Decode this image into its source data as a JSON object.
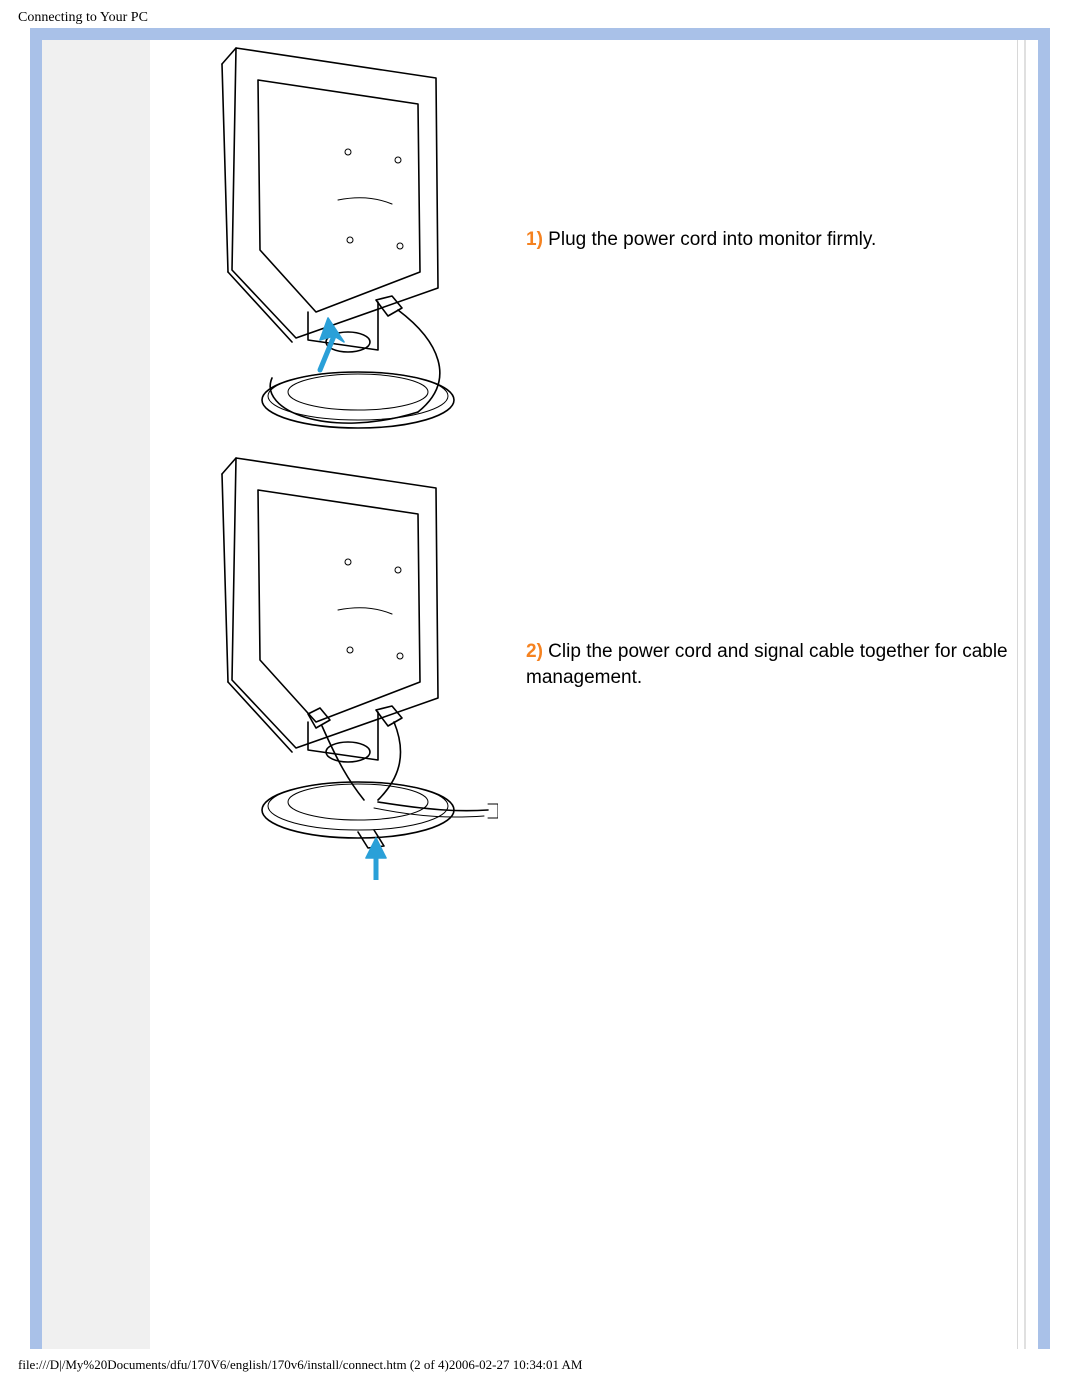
{
  "header": {
    "title": "Connecting to Your PC"
  },
  "steps": [
    {
      "num": "1)",
      "text": " Plug the power cord into monitor firmly."
    },
    {
      "num": "2)",
      "text": " Clip the power cord and signal cable together for cable management."
    }
  ],
  "footer": {
    "text": "file:///D|/My%20Documents/dfu/170V6/english/170v6/install/connect.htm (2 of 4)2006-02-27 10:34:01 AM"
  }
}
